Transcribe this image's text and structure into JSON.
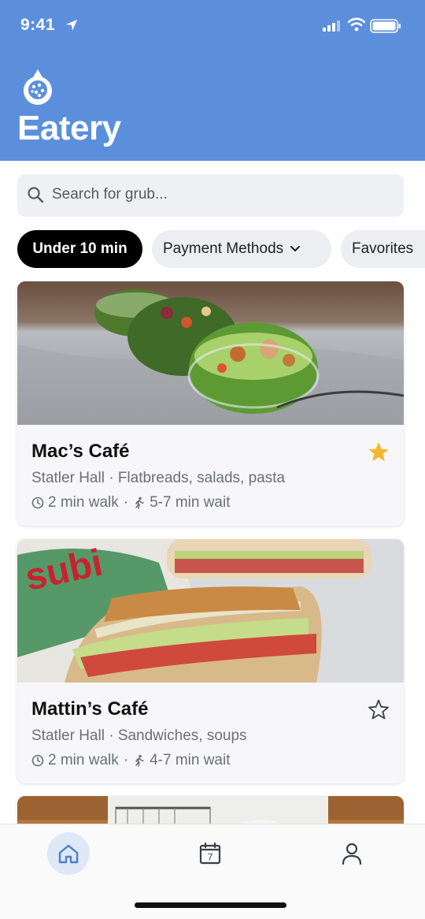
{
  "status_bar": {
    "time": "9:41"
  },
  "header": {
    "title": "Eatery"
  },
  "search": {
    "placeholder": "Search for grub..."
  },
  "filters": {
    "under_10": "Under 10 min",
    "payment": "Payment Methods",
    "favorites": "Favorites"
  },
  "eateries": [
    {
      "name": "Mac’s Café",
      "location": "Statler Hall",
      "cuisine": "Flatbreads, salads, pasta",
      "walk": "2 min walk",
      "wait": "5-7 min wait",
      "favorited": true
    },
    {
      "name": "Mattin’s Café",
      "location": "Statler Hall",
      "cuisine": "Sandwiches, soups",
      "walk": "2 min walk",
      "wait": "4-7 min wait",
      "favorited": false
    }
  ],
  "tabbar": {
    "calendar_day": "7",
    "icons": [
      "home-icon",
      "calendar-icon",
      "profile-icon"
    ]
  },
  "colors": {
    "header": "#5b8fdc",
    "star_active": "#f4b731",
    "chip_active": "#000000"
  }
}
